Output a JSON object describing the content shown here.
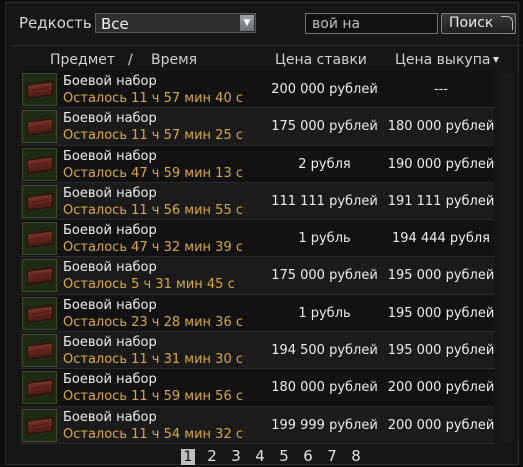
{
  "filter": {
    "label": "Редкость",
    "selected": "Все"
  },
  "search": {
    "value": "вой на",
    "button_label": "Поиск"
  },
  "columns": {
    "item": "Предмет",
    "slash": "/",
    "time": "Время",
    "bid": "Цена ставки",
    "buyout": "Цена выкупа"
  },
  "rows": [
    {
      "name": "Боевой набор",
      "time_left": "Осталось 11 ч 57 мин 40 с",
      "bid": "200 000 рублей",
      "buyout": "---"
    },
    {
      "name": "Боевой набор",
      "time_left": "Осталось 11 ч 57 мин 25 с",
      "bid": "175 000 рублей",
      "buyout": "180 000 рублей"
    },
    {
      "name": "Боевой набор",
      "time_left": "Осталось 47 ч 59 мин 13 с",
      "bid": "2 рубля",
      "buyout": "190 000 рублей"
    },
    {
      "name": "Боевой набор",
      "time_left": "Осталось 11 ч 56 мин 55 с",
      "bid": "111 111 рублей",
      "buyout": "191 111 рублей"
    },
    {
      "name": "Боевой набор",
      "time_left": "Осталось 47 ч 32 мин 39 с",
      "bid": "1 рубль",
      "buyout": "194 444 рубля"
    },
    {
      "name": "Боевой набор",
      "time_left": "Осталось 5 ч 31 мин 45 с",
      "bid": "175 000 рублей",
      "buyout": "195 000 рублей"
    },
    {
      "name": "Боевой набор",
      "time_left": "Осталось 23 ч 28 мин 36 с",
      "bid": "1 рубль",
      "buyout": "195 000 рублей"
    },
    {
      "name": "Боевой набор",
      "time_left": "Осталось 11 ч 31 мин 30 с",
      "bid": "194 500 рублей",
      "buyout": "195 000 рублей"
    },
    {
      "name": "Боевой набор",
      "time_left": "Осталось 11 ч 59 мин 56 с",
      "bid": "180 000 рублей",
      "buyout": "200 000 рублей"
    },
    {
      "name": "Боевой набор",
      "time_left": "Осталось 11 ч 54 мин 32 с",
      "bid": "199 999 рублей",
      "buyout": "200 000 рублей"
    }
  ],
  "pagination": {
    "current": "1",
    "pages": [
      "1",
      "2",
      "3",
      "4",
      "5",
      "6",
      "7",
      "8"
    ]
  },
  "icons": {
    "row_item": "crate-icon",
    "dropdown": "chevron-down-icon",
    "sort": "sort-desc-icon"
  },
  "colors": {
    "time_left": "#d8a93a",
    "background": "#161616"
  }
}
